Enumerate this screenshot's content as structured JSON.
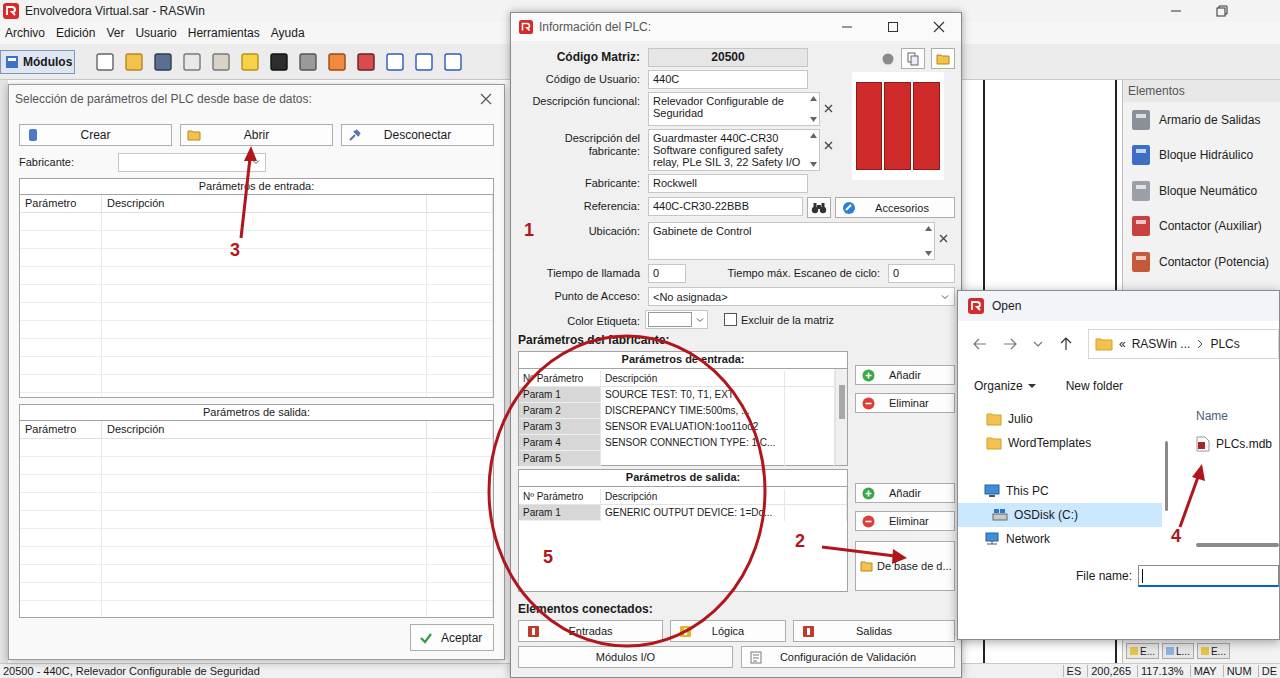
{
  "window": {
    "title": "Envolvedora Virtual.sar - RASWin"
  },
  "menu": [
    "Archivo",
    "Edición",
    "Ver",
    "Usuario",
    "Herramientas",
    "Ayuda"
  ],
  "modules_tab": {
    "label": "Módulos",
    "selected": true
  },
  "elements_panel": {
    "title": "Elementos",
    "items": [
      "Armario de Salidas",
      "Bloque Hidráulico",
      "Bloque Neumático",
      "Contactor (Auxiliar)",
      "Contactor (Potencia)"
    ]
  },
  "layer_tabs": [
    "E...",
    "L...",
    "E..."
  ],
  "status_bar": {
    "text": "20500 - 440C, Relevador Configurable de Seguridad",
    "indicators": [
      "ES",
      "200,265",
      "117.13%",
      "MAY",
      "NUM",
      "DE"
    ]
  },
  "db_dialog": {
    "title": "Selección de parámetros del PLC desde base de datos:",
    "buttons": [
      "Crear",
      "Abrir",
      "Desconectar"
    ],
    "manufacturer": {
      "label": "Fabricante:",
      "value": ""
    },
    "input_params": {
      "title": "Parámetros de entrada:",
      "columns": [
        "Parámetro",
        "Descripción"
      ],
      "rows": []
    },
    "output_params": {
      "title": "Parámetros de salida:",
      "columns": [
        "Parámetro",
        "Descripción"
      ],
      "rows": []
    },
    "ok_button": "Aceptar"
  },
  "plc_dialog": {
    "title": "Información del PLC:",
    "matrix_code": {
      "label": "Código Matriz:",
      "value": "20500"
    },
    "user_code": {
      "label": "Código de Usuario:",
      "value": "440C"
    },
    "functional_description": {
      "label": "Descripción funcional:",
      "value": "Relevador Configurable de Seguridad"
    },
    "manufacturer_description": {
      "label": "Descripción del fabricante:",
      "value": "Guardmaster 440C-CR30 Software configured safety relay, PLe SIL 3, 22 Safety I/O"
    },
    "manufacturer": {
      "label": "Fabricante:",
      "value": "Rockwell"
    },
    "reference": {
      "label": "Referencia:",
      "value": "440C-CR30-22BBB"
    },
    "accessories_button": "Accesorios",
    "location": {
      "label": "Ubicación:",
      "value": "Gabinete de Control"
    },
    "call_time": {
      "label": "Tiempo de llamada",
      "value": "0"
    },
    "max_scan_time": {
      "label": "Tiempo máx. Escaneo de ciclo:",
      "value": "0"
    },
    "access_point": {
      "label": "Punto de Acceso:",
      "value": "<No asignada>"
    },
    "label_color": {
      "label": "Color Etiqueta:",
      "color": "#ffffff"
    },
    "exclude_matrix": {
      "label": "Excluir de la matriz",
      "checked": false
    },
    "manufacturer_params_title": "Parámetros del fabricante:",
    "input_params": {
      "title": "Parámetros de entrada:",
      "columns": [
        "Nº Parámetro",
        "Descripción"
      ],
      "rows": [
        {
          "param": "Param 1",
          "description": "SOURCE TEST: T0, T1, EXT"
        },
        {
          "param": "Param 2",
          "description": "DISCREPANCY TIME:500ms, ..."
        },
        {
          "param": "Param 3",
          "description": "SENSOR EVALUATION:1oo11oo2"
        },
        {
          "param": "Param 4",
          "description": "SENSOR CONNECTION TYPE: 1 C..."
        },
        {
          "param": "Param 5",
          "description": ""
        }
      ]
    },
    "output_params": {
      "title": "Parámetros de salida:",
      "columns": [
        "Nº Parámetro",
        "Descripción"
      ],
      "rows": [
        {
          "param": "Param 1",
          "description": "GENERIC OUTPUT DEVICE: 1=Do..."
        }
      ]
    },
    "add_button": "Añadir",
    "remove_button": "Eliminar",
    "from_db_button": "De base de d...",
    "connected_title": "Elementos conectados:",
    "connected_buttons": [
      "Entradas",
      "Lógica",
      "Salidas"
    ],
    "bottom_buttons": [
      "Módulos I/O",
      "Configuración de Validación"
    ]
  },
  "open_dialog": {
    "title": "Open",
    "path": [
      "«",
      "RASWin ...",
      "PLCs"
    ],
    "organize": "Organize",
    "new_folder": "New folder",
    "tree": [
      {
        "label": "Julio",
        "kind": "folder",
        "selected": false
      },
      {
        "label": "WordTemplates",
        "kind": "folder",
        "selected": false
      },
      {
        "label": "This PC",
        "kind": "pc",
        "selected": false
      },
      {
        "label": "OSDisk (C:)",
        "kind": "drive",
        "selected": true
      },
      {
        "label": "Network",
        "kind": "network",
        "selected": false
      }
    ],
    "column": "Name",
    "files": [
      {
        "name": "PLCs.mdb",
        "selected": false
      }
    ],
    "file_name": {
      "label": "File name:",
      "value": ""
    }
  },
  "annotations": [
    "1",
    "2",
    "3",
    "4",
    "5"
  ]
}
